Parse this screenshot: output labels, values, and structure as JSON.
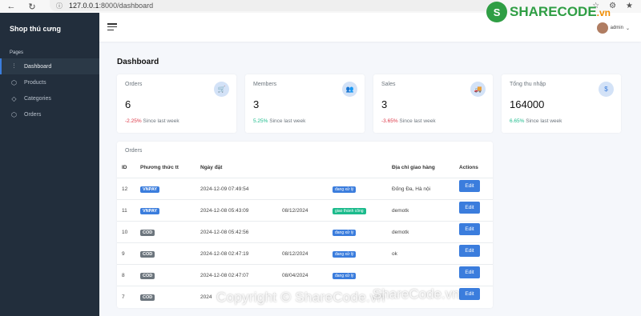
{
  "browser": {
    "url_host": "127.0.0.1",
    "url_path": ":8000/dashboard"
  },
  "sidebar": {
    "title": "Shop thú cưng",
    "section": "Pages",
    "items": [
      {
        "label": "Dashboard",
        "icon": "sliders-icon",
        "active": true
      },
      {
        "label": "Products",
        "icon": "box-icon",
        "active": false
      },
      {
        "label": "Categories",
        "icon": "tag-icon",
        "active": false
      },
      {
        "label": "Orders",
        "icon": "box-icon",
        "active": false
      }
    ]
  },
  "topbar": {
    "brand": "SHARECODE",
    "brand_suffix": ".vn",
    "user": "admin"
  },
  "main": {
    "title": "Dashboard",
    "cards": [
      {
        "label": "Orders",
        "value": "6",
        "change": "-2.25%",
        "change_type": "neg",
        "since": "Since last week",
        "icon": "cart-icon"
      },
      {
        "label": "Members",
        "value": "3",
        "change": "5.25%",
        "change_type": "pos",
        "since": "Since last week",
        "icon": "users-icon"
      },
      {
        "label": "Sales",
        "value": "3",
        "change": "-3.65%",
        "change_type": "neg",
        "since": "Since last week",
        "icon": "truck-icon"
      },
      {
        "label": "Tổng thu nhập",
        "value": "164000",
        "change": "6.65%",
        "change_type": "pos",
        "since": "Since last week",
        "icon": "dollar-icon"
      }
    ],
    "orders": {
      "title": "Orders",
      "headers": {
        "id": "ID",
        "payment": "Phương thức tt",
        "date": "Ngày đặt",
        "address": "Địa chỉ giao hàng",
        "actions": "Actions"
      },
      "rows": [
        {
          "id": "12",
          "payment": "VNPAY",
          "date": "2024-12-09 07:49:54",
          "ship": "",
          "status": "đang xử lý",
          "status_color": "blue",
          "address": "Đống Đa, Hà nội",
          "action": "Edit"
        },
        {
          "id": "11",
          "payment": "VNPAY",
          "date": "2024-12-08 05:43:09",
          "ship": "08/12/2024",
          "status": "giao thành công",
          "status_color": "green",
          "address": "demotk",
          "action": "Edit"
        },
        {
          "id": "10",
          "payment": "COD",
          "date": "2024-12-08 05:42:56",
          "ship": "",
          "status": "đang xử lý",
          "status_color": "blue",
          "address": "demotk",
          "action": "Edit"
        },
        {
          "id": "9",
          "payment": "COD",
          "date": "2024-12-08 02:47:19",
          "ship": "08/12/2024",
          "status": "đang xử lý",
          "status_color": "blue",
          "address": "ok",
          "action": "Edit"
        },
        {
          "id": "8",
          "payment": "COD",
          "date": "2024-12-08 02:47:07",
          "ship": "08/04/2024",
          "status": "đang xử lý",
          "status_color": "blue",
          "address": "",
          "action": "Edit"
        },
        {
          "id": "7",
          "payment": "COD",
          "date": "2024",
          "ship": "",
          "status": "",
          "status_color": "green",
          "address": "",
          "action": "Edit"
        }
      ]
    }
  },
  "watermark": "Copyright © ShareCode.vn",
  "watermark2": "ShareCode.vn"
}
